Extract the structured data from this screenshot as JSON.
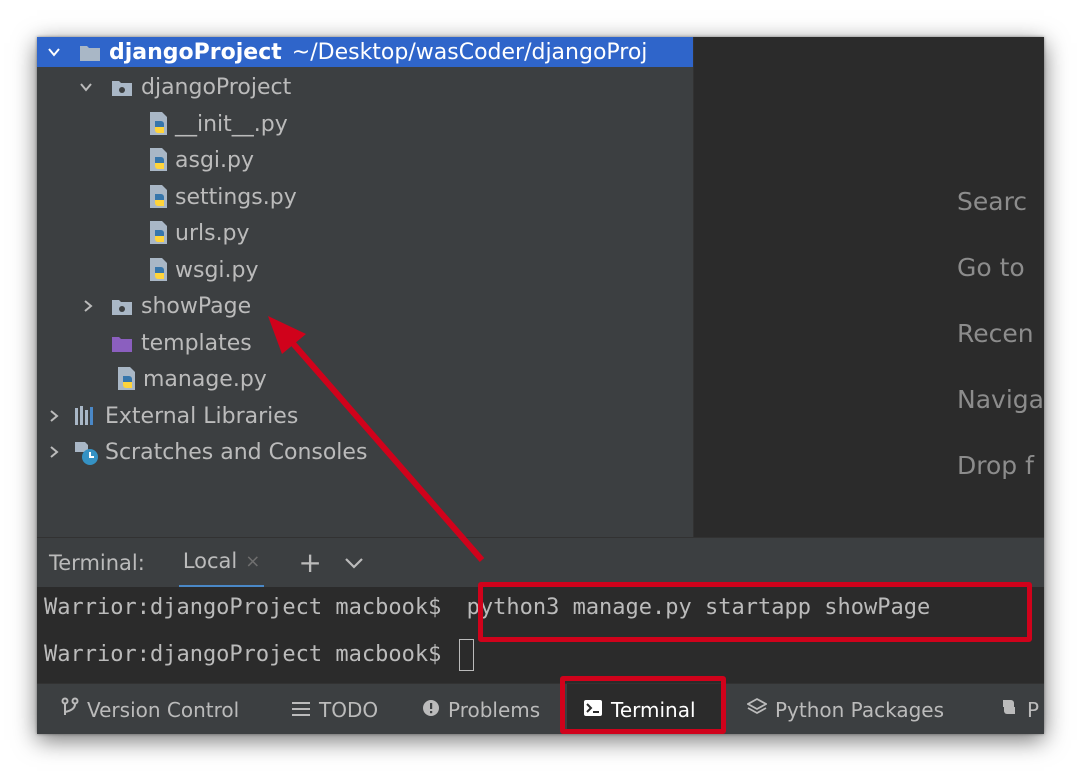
{
  "project_tree": {
    "root": {
      "name": "djangoProject",
      "path": "~/Desktop/wasCoder/djangoProj"
    },
    "items": [
      {
        "label": "djangoProject"
      },
      {
        "label": "__init__.py"
      },
      {
        "label": "asgi.py"
      },
      {
        "label": "settings.py"
      },
      {
        "label": "urls.py"
      },
      {
        "label": "wsgi.py"
      },
      {
        "label": "showPage"
      },
      {
        "label": "templates"
      },
      {
        "label": "manage.py"
      },
      {
        "label": "External Libraries"
      },
      {
        "label": "Scratches and Consoles"
      }
    ]
  },
  "editor_hints": [
    "Searc",
    "Go to",
    "Recen",
    "Naviga",
    "Drop f"
  ],
  "terminal": {
    "label": "Terminal:",
    "tab": "Local",
    "tab_close": "×",
    "add": "+",
    "lines": [
      {
        "prompt": "Warrior:djangoProject macbook$",
        "command": "python3 manage.py startapp showPage"
      },
      {
        "prompt": "Warrior:djangoProject macbook$",
        "command": ""
      }
    ]
  },
  "toolbar": {
    "items": [
      {
        "label": "Version Control",
        "icon": "branch-icon"
      },
      {
        "label": "TODO",
        "icon": "list-icon"
      },
      {
        "label": "Problems",
        "icon": "warning-icon"
      },
      {
        "label": "Terminal",
        "icon": "terminal-icon",
        "active": true
      },
      {
        "label": "Python Packages",
        "icon": "layers-icon"
      },
      {
        "label": "P",
        "icon": "python-icon"
      }
    ]
  },
  "colors": {
    "selection": "#2f65ca",
    "panel": "#3c3f41",
    "editor": "#2b2b2b",
    "annotation": "#d0021b",
    "folder": "#a9b7c6",
    "templates_folder": "#8b5fbf"
  }
}
